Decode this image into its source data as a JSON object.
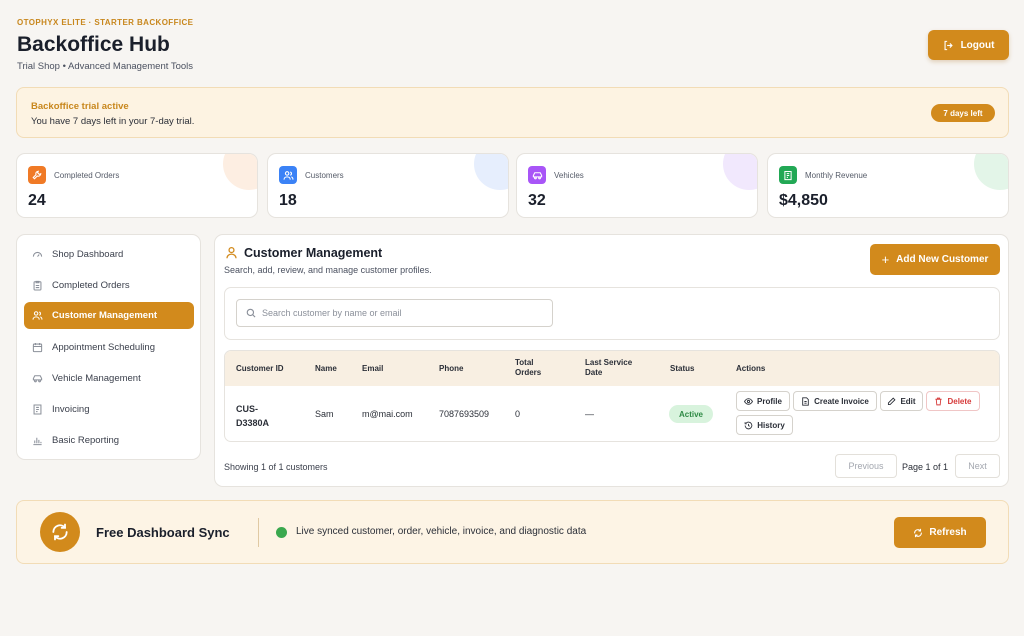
{
  "header": {
    "eyebrow": "OTOPHYX ELITE · STARTER BACKOFFICE",
    "title": "Backoffice Hub",
    "subtitle": "Trial Shop • Advanced Management Tools",
    "logout_label": "Logout"
  },
  "trial": {
    "title": "Backoffice trial active",
    "text": "You have 7 days left in your 7-day trial.",
    "badge": "7 days left"
  },
  "stats": [
    {
      "label": "Completed Orders",
      "value": "24",
      "icon": "wrench-icon",
      "color": "#f07a26"
    },
    {
      "label": "Customers",
      "value": "18",
      "icon": "users-icon",
      "color": "#3b82f6"
    },
    {
      "label": "Vehicles",
      "value": "32",
      "icon": "car-icon",
      "color": "#a855f7"
    },
    {
      "label": "Monthly Revenue",
      "value": "$4,850",
      "icon": "receipt-icon",
      "color": "#22a855"
    }
  ],
  "sidebar": {
    "items": [
      {
        "label": "Shop Dashboard",
        "icon": "gauge-icon",
        "active": false
      },
      {
        "label": "Completed Orders",
        "icon": "clipboard-icon",
        "active": false
      },
      {
        "label": "Customer Management",
        "icon": "users-icon",
        "active": true
      },
      {
        "label": "Appointment Scheduling",
        "icon": "calendar-icon",
        "active": false
      },
      {
        "label": "Vehicle Management",
        "icon": "car-icon",
        "active": false
      },
      {
        "label": "Invoicing",
        "icon": "invoice-icon",
        "active": false
      },
      {
        "label": "Basic Reporting",
        "icon": "bar-chart-icon",
        "active": false
      }
    ]
  },
  "main": {
    "title": "Customer Management",
    "subtitle": "Search, add, review, and manage customer profiles.",
    "add_label": "Add New Customer",
    "search_placeholder": "Search customer by name or email",
    "search_value": "",
    "columns": [
      "Customer ID",
      "Name",
      "Email",
      "Phone",
      "Total Orders",
      "Last Service Date",
      "Status",
      "Actions"
    ],
    "rows": [
      {
        "id": "CUS-D3380A",
        "name": "Sam",
        "email": "m@mai.com",
        "phone": "7087693509",
        "total_orders": "0",
        "last_service": "—",
        "status": "Active"
      }
    ],
    "actions": {
      "profile": "Profile",
      "invoice": "Create Invoice",
      "edit": "Edit",
      "delete": "Delete",
      "history": "History"
    },
    "showing": "Showing 1 of 1 customers",
    "pagination": {
      "previous": "Previous",
      "page": "Page 1 of 1",
      "next": "Next"
    }
  },
  "sync": {
    "title": "Free Dashboard Sync",
    "text": "Live synced customer, order, vehicle, invoice, and diagnostic data",
    "refresh_label": "Refresh"
  },
  "colors": {
    "accent": "#d28a1c",
    "success": "#3aa84e",
    "danger": "#d63b3b"
  }
}
